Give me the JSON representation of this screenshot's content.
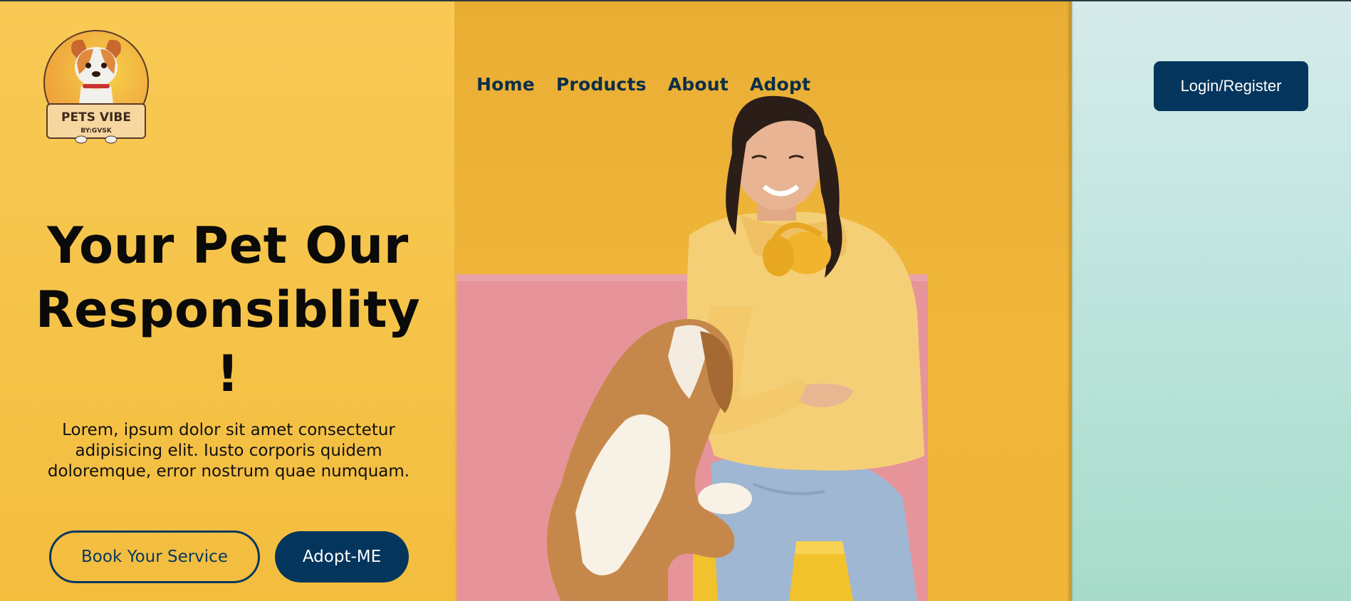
{
  "nav": {
    "items": [
      {
        "label": "Home"
      },
      {
        "label": "Products"
      },
      {
        "label": "About"
      },
      {
        "label": "Adopt"
      }
    ],
    "login_label": "Login/Register"
  },
  "logo": {
    "brand_text": "PETS VIBE",
    "sub_text": "BY:GVSK",
    "icon": "dog-mascot-icon"
  },
  "hero": {
    "title_line1": "Your Pet Our",
    "title_line2": "Responsiblity",
    "title_line3": "!",
    "description": "Lorem, ipsum dolor sit amet consectetur adipisicing elit. Iusto corporis quidem doloremque, error nostrum quae numquam.",
    "primary_button": "Book Your Service",
    "secondary_button": "Adopt-ME",
    "image": "woman-with-dog-photo"
  },
  "colors": {
    "accent": "#04355c",
    "left_panel": "#f5c348",
    "center_panel": "#eeb33a",
    "right_panel": "#bfe4dc"
  }
}
